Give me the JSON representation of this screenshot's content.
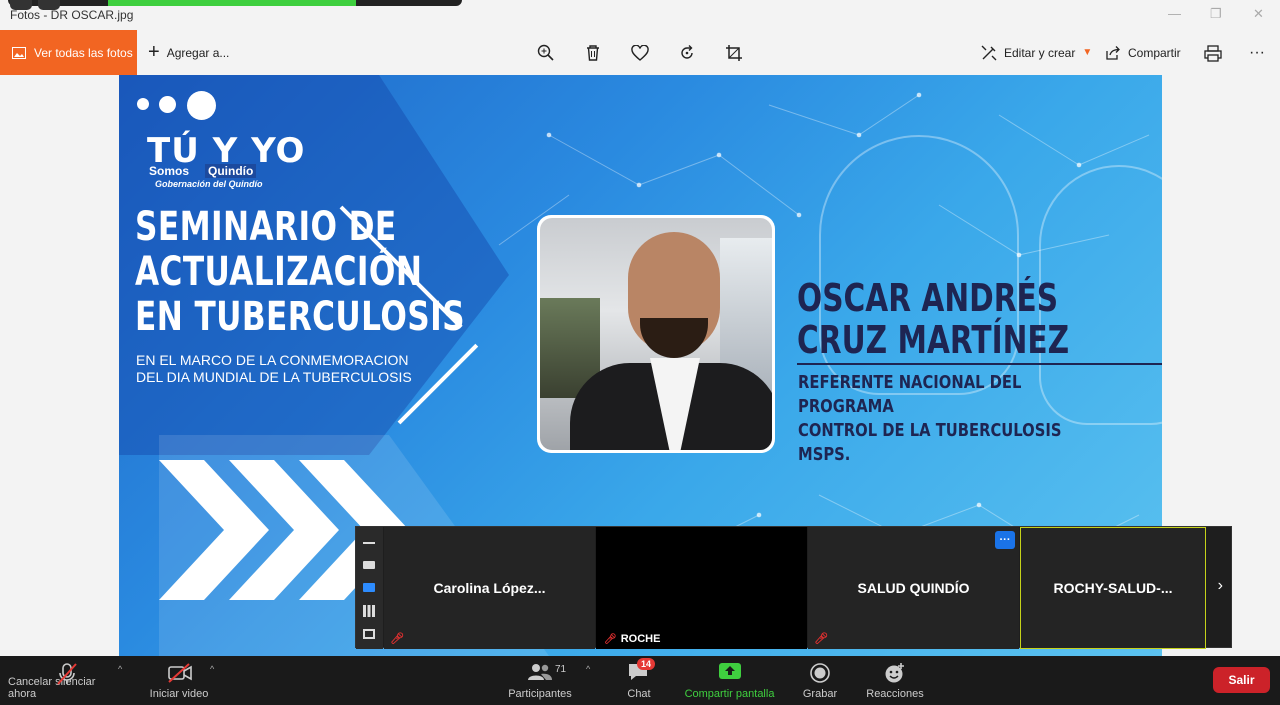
{
  "window": {
    "title": "Fotos - DR OSCAR.jpg",
    "minimize": "—",
    "maximize": "❐",
    "close": "✕"
  },
  "toolbar": {
    "all_photos": "Ver todas las fotos",
    "add_to": "Agregar a...",
    "edit_create": "Editar y crear",
    "share": "Compartir",
    "more": "···"
  },
  "slide": {
    "logo_main": "TÚ Y YO",
    "logo_somos": "Somos",
    "logo_quindio": "Quindío",
    "logo_gob": "Gobernación del Quindío",
    "title_lines": [
      "SEMINARIO DE",
      "ACTUALIZACIÓN",
      "EN TUBERCULOSIS"
    ],
    "subtitle_lines": [
      "EN EL MARCO DE LA CONMEMORACION",
      "DEL DIA MUNDIAL DE LA TUBERCULOSIS"
    ],
    "speaker_lines": [
      "OSCAR ANDRÉS",
      "CRUZ MARTÍNEZ"
    ],
    "role_lines": [
      "REFERENTE NACIONAL DEL PROGRAMA",
      "CONTROL DE LA TUBERCULOSIS MSPS."
    ],
    "colors": {
      "primary_blue": "#1f66c8",
      "light_blue": "#5cc3f0",
      "navy_text": "#1e2552"
    }
  },
  "video_strip": {
    "participants": [
      {
        "name": "Carolina  López...",
        "muted": true,
        "label": ""
      },
      {
        "name": "",
        "muted": true,
        "label": "ROCHE"
      },
      {
        "name": "SALUD QUINDÍO",
        "muted": true,
        "label": ""
      },
      {
        "name": "ROCHY-SALUD-...",
        "muted": false,
        "label": ""
      }
    ],
    "more_label": "···",
    "next_arrow": "›"
  },
  "zoom_bar": {
    "unmute": "Cancelar silenciar ahora",
    "start_video": "Iniciar video",
    "participants": "Participantes",
    "participants_count": "71",
    "chat": "Chat",
    "chat_badge": "14",
    "share_screen": "Compartir pantalla",
    "record": "Grabar",
    "reactions": "Reacciones",
    "leave": "Salir",
    "caret": "^"
  }
}
